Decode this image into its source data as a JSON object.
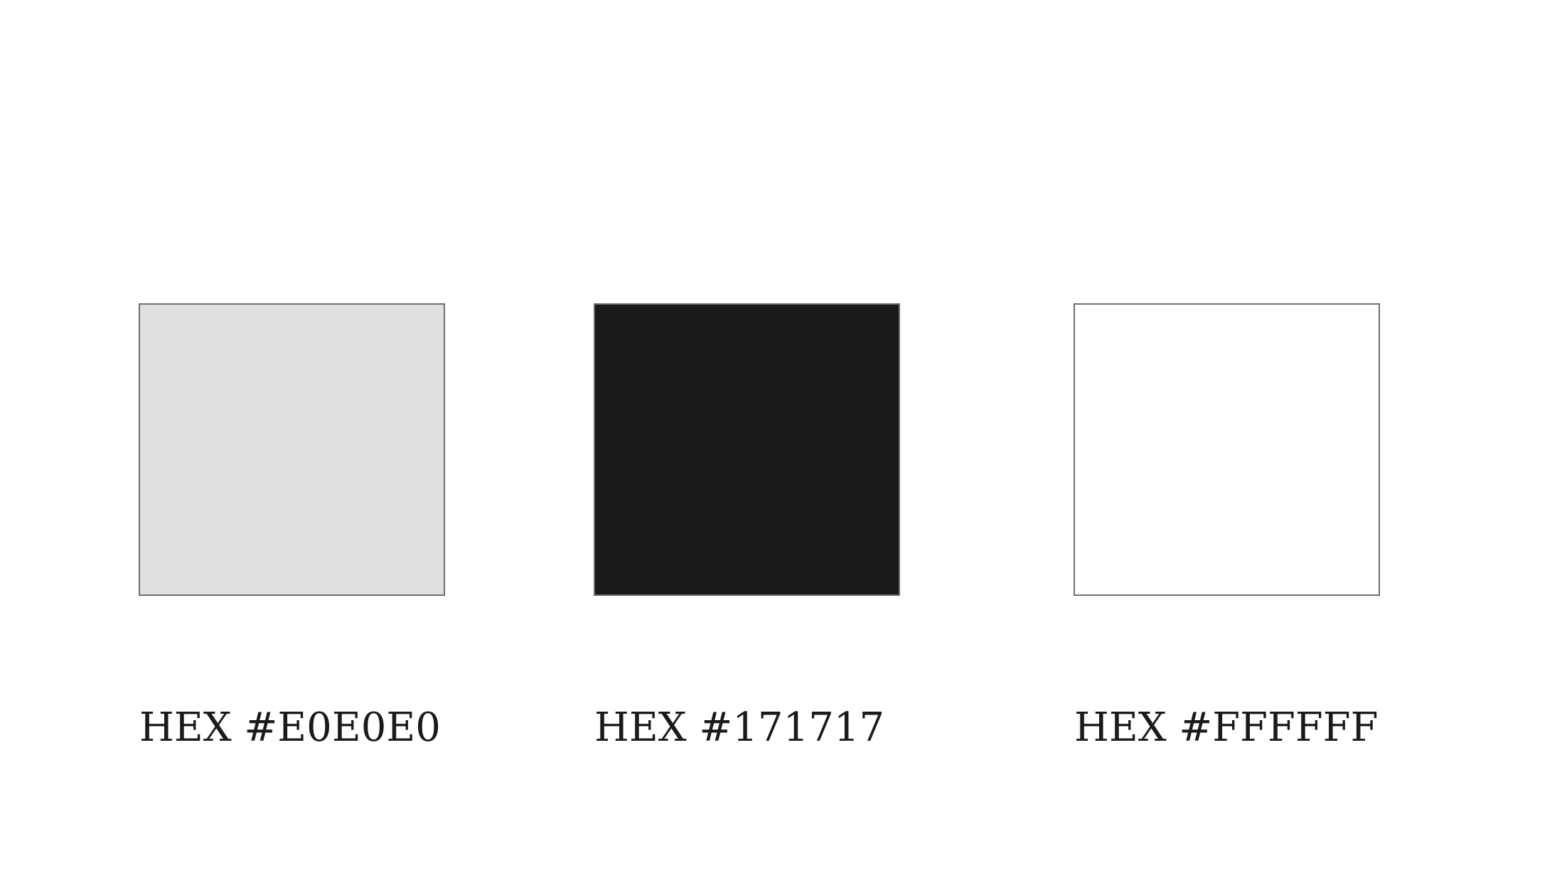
{
  "swatches": [
    {
      "color": "#E0E0E0",
      "label": "HEX #E0E0E0"
    },
    {
      "color": "#1A1A1A",
      "label": "HEX #171717"
    },
    {
      "color": "#FFFFFF",
      "label": "HEX #FFFFFF"
    }
  ]
}
